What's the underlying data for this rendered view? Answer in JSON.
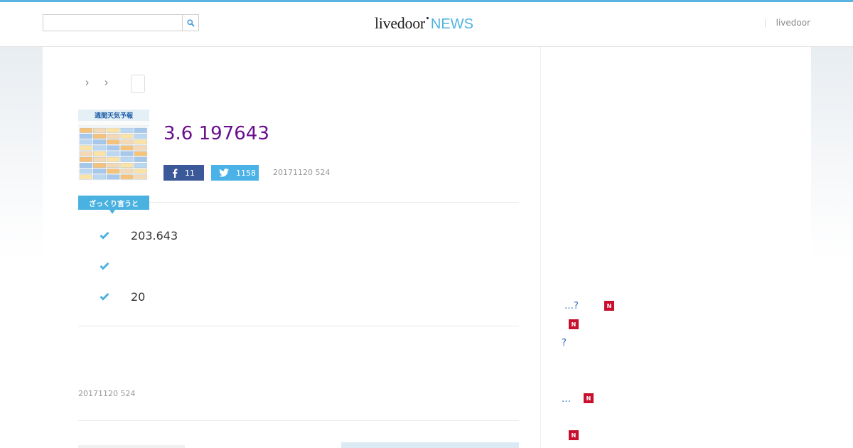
{
  "header": {
    "search_placeholder": "",
    "search_button_label": "Search",
    "logo_main": "livedoor",
    "logo_news": "NEWS",
    "right_link": "livedoor"
  },
  "breadcrumb": {
    "current": ""
  },
  "article": {
    "title": "3.6 197643",
    "facebook_count": "11",
    "twitter_count": "1158",
    "date": "20171120 524",
    "badge": "ざっくり言うと",
    "points": [
      "203.643",
      "",
      "20"
    ],
    "date_bottom": "20171120 524"
  },
  "thumbnail": {
    "label": "週間天気予報"
  },
  "sidebar": {
    "new_label": "N",
    "items": [
      {
        "text": "…?"
      },
      {
        "text": ""
      },
      {
        "text": "?"
      },
      {
        "text": "…"
      },
      {
        "text": ""
      }
    ]
  },
  "colors": {
    "accent": "#58b4e0",
    "title": "#6a0e8e",
    "facebook": "#3b5998",
    "twitter": "#4ab2e6",
    "badge": "#4ab2e0",
    "new_badge": "#c8102e",
    "link": "#2b6db6"
  },
  "icons": {
    "search": "search-icon",
    "facebook": "facebook-icon",
    "twitter": "twitter-icon",
    "check": "check-icon",
    "chevron": "chevron-right-icon"
  }
}
